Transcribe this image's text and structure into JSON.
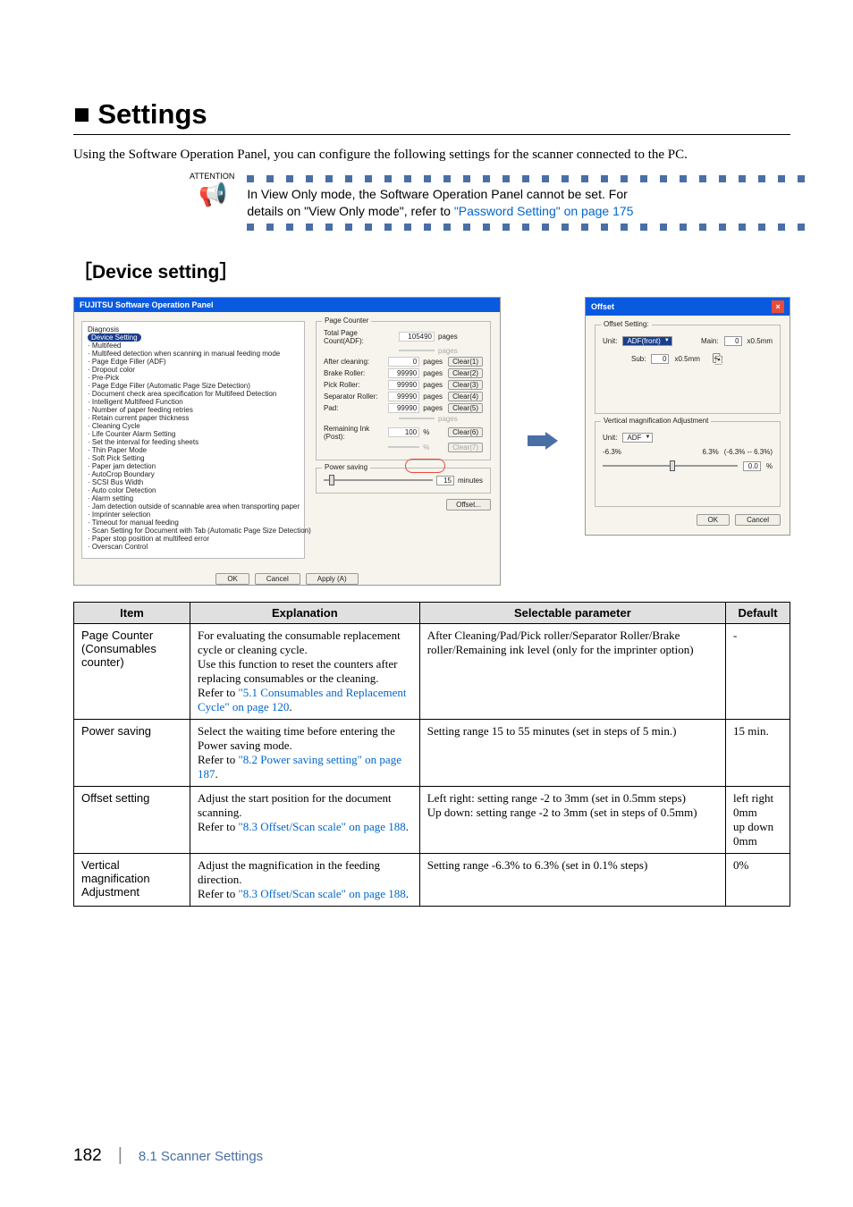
{
  "h1": "■  Settings",
  "lead": "Using the Software Operation Panel, you can configure the following settings for the scanner connected to the PC.",
  "attention": {
    "label": "ATTENTION",
    "text_line1": "In View Only mode, the Software Operation Panel cannot be set. For",
    "text_line2": "details on \"View Only mode\", refer to ",
    "link": "\"Password Setting\" on page 175"
  },
  "h2": "［Device setting］",
  "sop": {
    "title": "FUJITSU Software Operation Panel",
    "diag": "Diagnosis",
    "selected": "Device Setting",
    "tree": [
      "Multifeed",
      "Multifeed detection when scanning in manual feeding mode",
      "Page Edge Filler (ADF)",
      "Dropout color",
      "Pre-Pick",
      "Page Edge Filler (Automatic Page Size Detection)",
      "Document check area specification for Multifeed Detection",
      "Intelligent Multifeed Function",
      "Number of paper feeding retries",
      "Retain current paper thickness",
      "Cleaning Cycle",
      "Life Counter Alarm Setting",
      "Set the interval for feeding sheets",
      "Thin Paper Mode",
      "Soft Pick Setting",
      "Paper jam detection",
      "AutoCrop Boundary",
      "SCSI Bus Width",
      "Auto color Detection",
      "Alarm setting",
      "Jam detection outside of scannable area when transporting paper",
      "Imprinter selection",
      "Timeout for manual feeding",
      "Scan Setting for Document with Tab (Automatic Page Size Detection)",
      "Paper stop position at multifeed error",
      "Overscan Control"
    ],
    "page_counter": {
      "title": "Page Counter",
      "rows": [
        {
          "label": "Total Page Count(ADF):",
          "value": "105490",
          "unit": "pages",
          "btn": ""
        },
        {
          "label": "",
          "value": "",
          "unit": "pages",
          "btn": "",
          "disabled": true
        },
        {
          "label": "After cleaning:",
          "value": "0",
          "unit": "pages",
          "btn": "Clear(1)"
        },
        {
          "label": "Brake Roller:",
          "value": "99990",
          "unit": "pages",
          "btn": "Clear(2)"
        },
        {
          "label": "Pick Roller:",
          "value": "99990",
          "unit": "pages",
          "btn": "Clear(3)"
        },
        {
          "label": "Separator Roller:",
          "value": "99990",
          "unit": "pages",
          "btn": "Clear(4)"
        },
        {
          "label": "Pad:",
          "value": "99990",
          "unit": "pages",
          "btn": "Clear(5)"
        },
        {
          "label": "",
          "value": "",
          "unit": "pages",
          "btn": "",
          "disabled": true
        },
        {
          "label": "Remaining Ink (Post):",
          "value": "100",
          "unit": "%",
          "btn": "Clear(6)"
        },
        {
          "label": "",
          "value": "",
          "unit": "%",
          "btn": "Clear(7)",
          "disabled": true
        }
      ]
    },
    "power_saving": {
      "title": "Power saving",
      "value": "15",
      "unit": "minutes"
    },
    "offset_btn": "Offset...",
    "buttons": {
      "ok": "OK",
      "cancel": "Cancel",
      "apply": "Apply (A)"
    }
  },
  "offset": {
    "title": "Offset",
    "group1": "Offset Setting:",
    "unit": "Unit:",
    "unit_val": "ADF(front)",
    "main": "Main:",
    "main_val": "0",
    "main_unit": "x0.5mm",
    "sub": "Sub:",
    "sub_val": "0",
    "sub_unit": "x0.5mm",
    "group2": "Vertical magnification Adjustment",
    "unit2": "Unit:",
    "unit2_val": "ADF",
    "range_left": "-6.3%",
    "range_right": "6.3%",
    "range_note": "(-6.3% -- 6.3%)",
    "mag_val": "0.0",
    "mag_unit": "%",
    "ok": "OK",
    "cancel": "Cancel"
  },
  "table": {
    "headers": {
      "item": "Item",
      "exp": "Explanation",
      "sel": "Selectable parameter",
      "def": "Default"
    },
    "rows": [
      {
        "item": "Page Counter (Consumables counter)",
        "exp": "For evaluating the consumable replacement cycle or cleaning cycle.\nUse this function to reset the counters after replacing consumables or the cleaning.\nRefer to ",
        "exp_link": "\"5.1 Consumables and Replacement Cycle\" on page 120",
        "exp_after": ".",
        "sel": "After Cleaning/Pad/Pick roller/Separator Roller/Brake roller/Remaining ink level (only for the imprinter option)",
        "def": "-"
      },
      {
        "item": "Power saving",
        "exp": "Select the waiting time before entering the Power saving mode.\nRefer to ",
        "exp_link": "\"8.2 Power saving setting\" on page 187",
        "exp_after": ".",
        "sel": "Setting range 15 to 55 minutes (set in steps of 5 min.)",
        "def": "15 min."
      },
      {
        "item": "Offset setting",
        "exp": "Adjust the start position for the document scanning.\nRefer to ",
        "exp_link": "\"8.3 Offset/Scan scale\" on page 188",
        "exp_after": ".",
        "sel": "Left right: setting range -2 to 3mm (set in 0.5mm steps)\nUp down: setting range -2 to 3mm (set in steps of 0.5mm)",
        "def": "left right 0mm\nup down 0mm"
      },
      {
        "item": "Vertical magnification Adjustment",
        "exp": "Adjust the magnification in the feeding direction.\nRefer to ",
        "exp_link": "\"8.3 Offset/Scan scale\" on page 188",
        "exp_after": ".",
        "sel": "Setting range -6.3% to 6.3% (set in 0.1% steps)",
        "def": "0%"
      }
    ]
  },
  "footer": {
    "page": "182",
    "title": "8.1 Scanner Settings"
  }
}
